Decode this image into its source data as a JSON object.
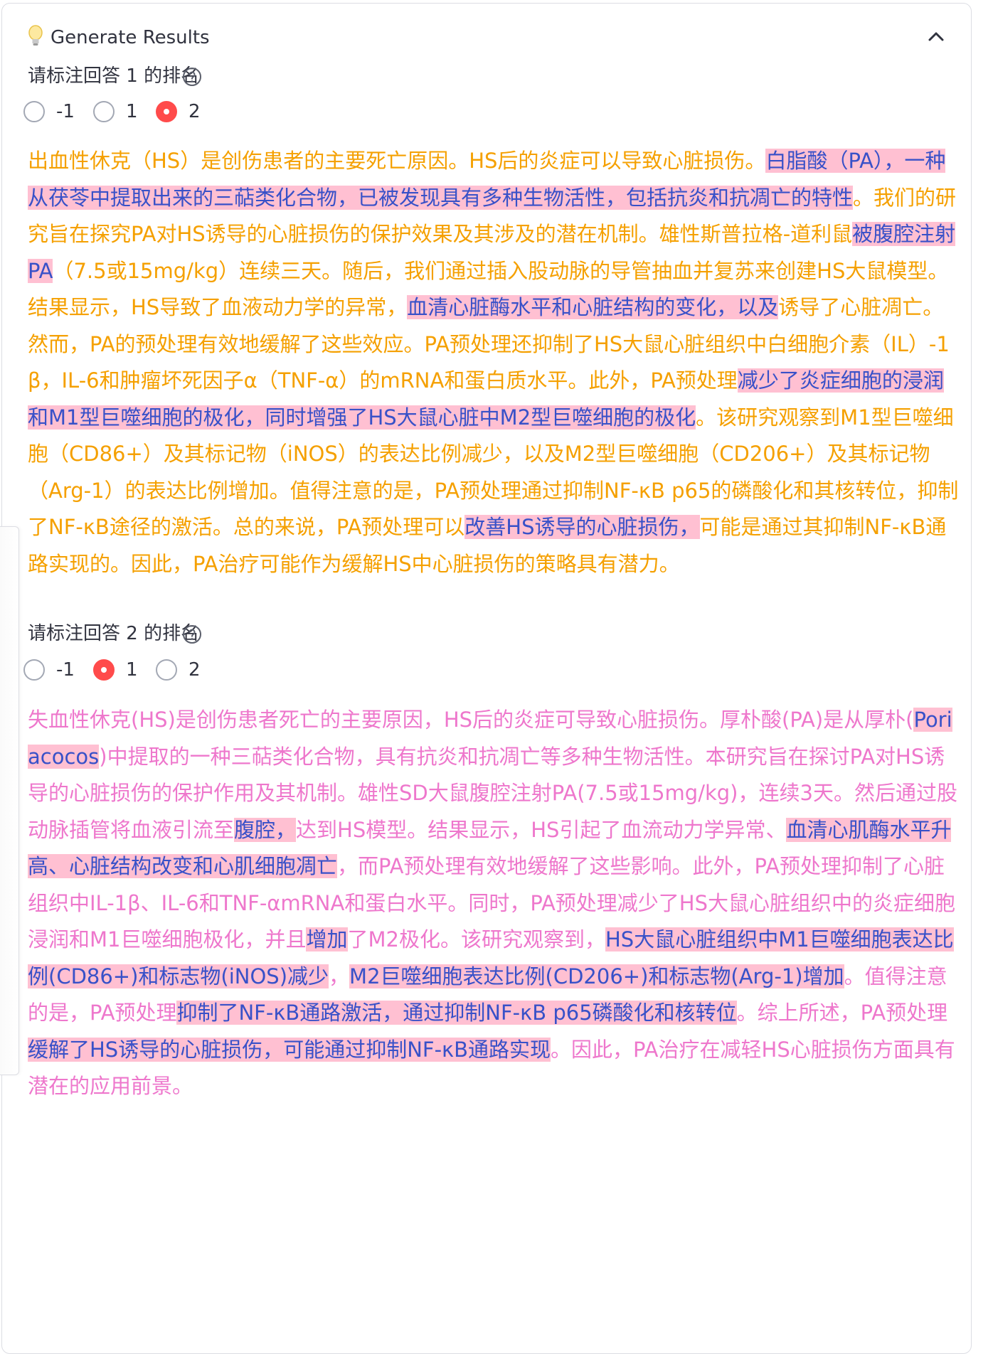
{
  "expander": {
    "title": "Generate Results",
    "icons": {
      "bulb": "lightbulb-icon",
      "toggle": "chevron-up-icon"
    }
  },
  "questions": [
    {
      "label": "请标注回答 1 的排名",
      "options": [
        "-1",
        "1",
        "2"
      ],
      "selected": "2",
      "segments": [
        {
          "text": "出血性休克（HS）是创伤患者的主要死亡原因。HS后的炎症可以导致心脏损伤。",
          "highlight": false
        },
        {
          "text": "白脂酸（PA），一种从茯苓中提取出来的三萜类化合物，已被发现具有多种生物活性，包括抗炎和抗凋亡的特性",
          "highlight": true
        },
        {
          "text": "。我们的研究旨在探究PA对HS诱导的心脏损伤的保护效果及其涉及的潜在机制。雄性斯普拉格-道利鼠",
          "highlight": false
        },
        {
          "text": "被腹腔注射PA",
          "highlight": true
        },
        {
          "text": "（7.5或15mg/kg）连续三天。随后，我们通过插入股动脉的导管抽血并复苏来创建HS大鼠模型。结果显示，HS导致了血液动力学的异常，",
          "highlight": false
        },
        {
          "text": "血清心脏酶水平和心脏结构的变化，以及",
          "highlight": true
        },
        {
          "text": "诱导了心脏凋亡。然而，PA的预处理有效地缓解了这些效应。PA预处理还抑制了HS大鼠心脏组织中白细胞介素（IL）-1β，IL-6和肿瘤坏死因子α（TNF-α）的mRNA和蛋白质水平。此外，PA预处理",
          "highlight": false
        },
        {
          "text": "减少了炎症细胞的浸润和M1型巨噬细胞的极化，同时增强了HS大鼠心脏中M2型巨噬细胞的极化",
          "highlight": true
        },
        {
          "text": "。该研究观察到M1型巨噬细胞（CD86+）及其标记物（iNOS）的表达比例减少，以及M2型巨噬细胞（CD206+）及其标记物（Arg-1）的表达比例增加。值得注意的是，PA预处理通过抑制NF-κB p65的磷酸化和其核转位，抑制了NF-κB途径的激活。总的来说，PA预处理可以",
          "highlight": false
        },
        {
          "text": "改善HS诱导的心脏损伤，",
          "highlight": true
        },
        {
          "text": "可能是通过其抑制NF-κB通路实现的。因此，PA治疗可能作为缓解HS中心脏损伤的策略具有潜力。",
          "highlight": false
        }
      ]
    },
    {
      "label": "请标注回答 2 的排名",
      "options": [
        "-1",
        "1",
        "2"
      ],
      "selected": "1",
      "segments": [
        {
          "text": "失血性休克(HS)是创伤患者死亡的主要原因，HS后的炎症可导致心脏损伤。厚朴酸(PA)是从厚朴(",
          "highlight": false
        },
        {
          "text": "Poriacocos",
          "highlight": true
        },
        {
          "text": ")中提取的一种三萜类化合物，具有抗炎和抗凋亡等多种生物活性。本研究旨在探讨PA对HS诱导的心脏损伤的保护作用及其机制。雄性SD大鼠腹腔注射PA(7.5或15mg/kg)，连续3天。然后通过股动脉插管将血液引流至",
          "highlight": false
        },
        {
          "text": "腹腔，",
          "highlight": true
        },
        {
          "text": "达到HS模型。结果显示，HS引起了血流动力学异常、",
          "highlight": false
        },
        {
          "text": "血清心肌酶水平升高、心脏结构改变和心肌细胞凋亡",
          "highlight": true
        },
        {
          "text": "，而PA预处理有效地缓解了这些影响。此外，PA预处理抑制了心脏组织中IL-1β、IL-6和TNF-αmRNA和蛋白水平。同时，PA预处理减少了HS大鼠心脏组织中的炎症细胞浸润和M1巨噬细胞极化，并且",
          "highlight": false
        },
        {
          "text": "增加",
          "highlight": true
        },
        {
          "text": "了M2极化。该研究观察到，",
          "highlight": false
        },
        {
          "text": "HS大鼠心脏组织中M1巨噬细胞表达比例(CD86+)和标志物(iNOS)减少",
          "highlight": true
        },
        {
          "text": "，",
          "highlight": false
        },
        {
          "text": "M2巨噬细胞表达比例(CD206+)和标志物(Arg-1)增加",
          "highlight": true
        },
        {
          "text": "。值得注意的是，PA预处理",
          "highlight": false
        },
        {
          "text": "抑制了NF-κB通路激活，通过抑制NF-κB p65磷酸化和核转位",
          "highlight": true
        },
        {
          "text": "。综上所述，PA预处理",
          "highlight": false
        },
        {
          "text": "缓解了HS诱导的心脏损伤，可能通过抑制NF-κB通路实现",
          "highlight": true
        },
        {
          "text": "。因此，PA治疗在减轻HS心脏损伤方面具有潜在的应用前景。",
          "highlight": false
        }
      ]
    }
  ],
  "colors": {
    "answer1_text": "#f5a000",
    "answer2_text": "#ee77cc",
    "highlight_bg": "#ffc0d2",
    "highlight_text": "#3851c8",
    "radio_selected": "#ff4b4b"
  }
}
